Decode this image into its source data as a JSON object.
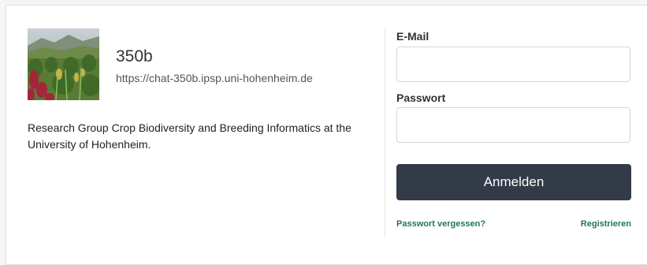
{
  "server": {
    "name": "350b",
    "url": "https://chat-350b.ipsp.uni-hohenheim.de",
    "description": "Research Group Crop Biodiversity and Breeding Informatics at the University of Hohenheim.",
    "image_icon": "crop-field-photo"
  },
  "login": {
    "email_label": "E-Mail",
    "email_value": "",
    "password_label": "Passwort",
    "password_value": "",
    "submit_label": "Anmelden",
    "forgot_label": "Passwort vergessen?",
    "register_label": "Registrieren"
  },
  "colors": {
    "button_bg": "#343b48",
    "link": "#1f7a4d"
  }
}
